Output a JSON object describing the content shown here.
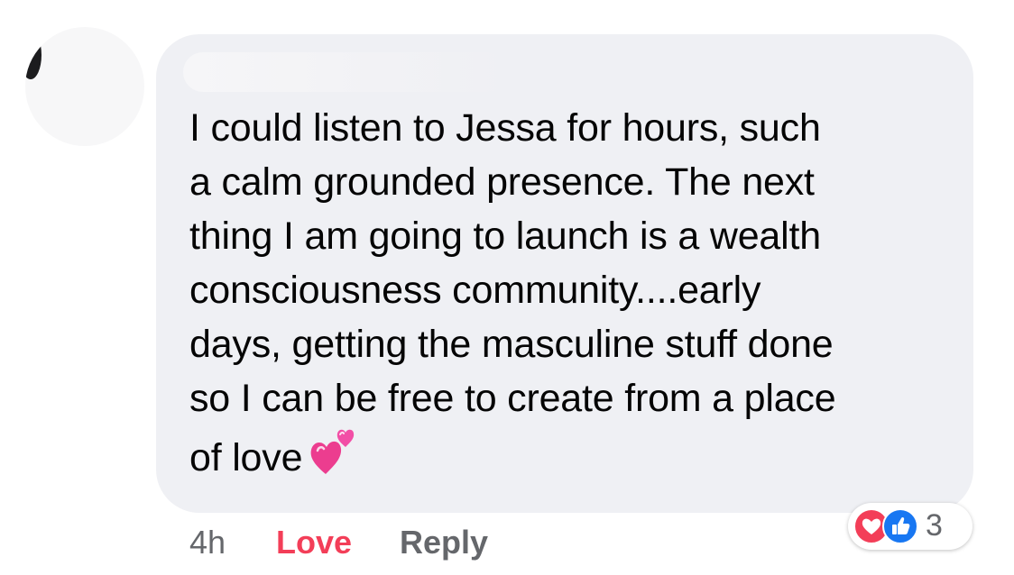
{
  "comment": {
    "text": "I could listen to Jessa for hours, such\na calm grounded presence. The next\nthing I am going to launch is a wealth\nconsciousness community....early\ndays, getting the masculine stuff done\nso I can be free to create from a place\nof love",
    "emoji": "two-hearts-emoji"
  },
  "footer": {
    "time": "4h",
    "love_label": "Love",
    "reply_label": "Reply"
  },
  "reactions": {
    "icons": [
      "heart-reaction-icon",
      "like-reaction-icon"
    ],
    "count": "3"
  },
  "colors": {
    "bubble": "#eff0f4",
    "love": "#f33e58",
    "like": "#1877f2",
    "muted": "#65676b"
  }
}
